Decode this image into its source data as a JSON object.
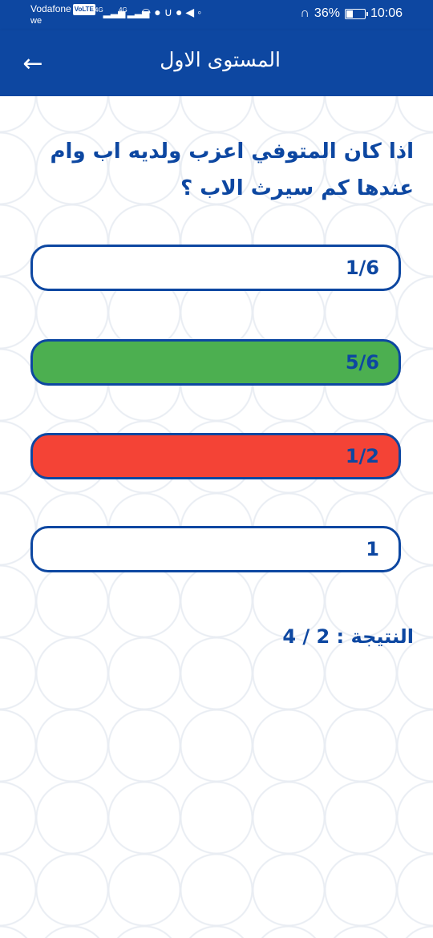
{
  "status_bar": {
    "carrier": "Vodafone",
    "volte": "VoLTE",
    "carrier_sub": "we",
    "signal_1": "4G",
    "signal_2": "4G",
    "battery": "36%",
    "time": "10:06"
  },
  "app_bar": {
    "title": "المستوى الاول"
  },
  "question": {
    "text": "اذا كان المتوفي اعزب ولديه اب وام عندها كم سيرث الاب ؟"
  },
  "options": [
    {
      "label": "1/6",
      "state": "default",
      "color": "#ffffff"
    },
    {
      "label": "5/6",
      "state": "correct",
      "color": "#4caf50"
    },
    {
      "label": "1/2",
      "state": "wrong",
      "color": "#f44336"
    },
    {
      "label": "1",
      "state": "default",
      "color": "#ffffff"
    }
  ],
  "score": {
    "label": "النتيجة : 2 / 4"
  },
  "colors": {
    "primary": "#0d47a1",
    "correct": "#4caf50",
    "wrong": "#f44336"
  }
}
